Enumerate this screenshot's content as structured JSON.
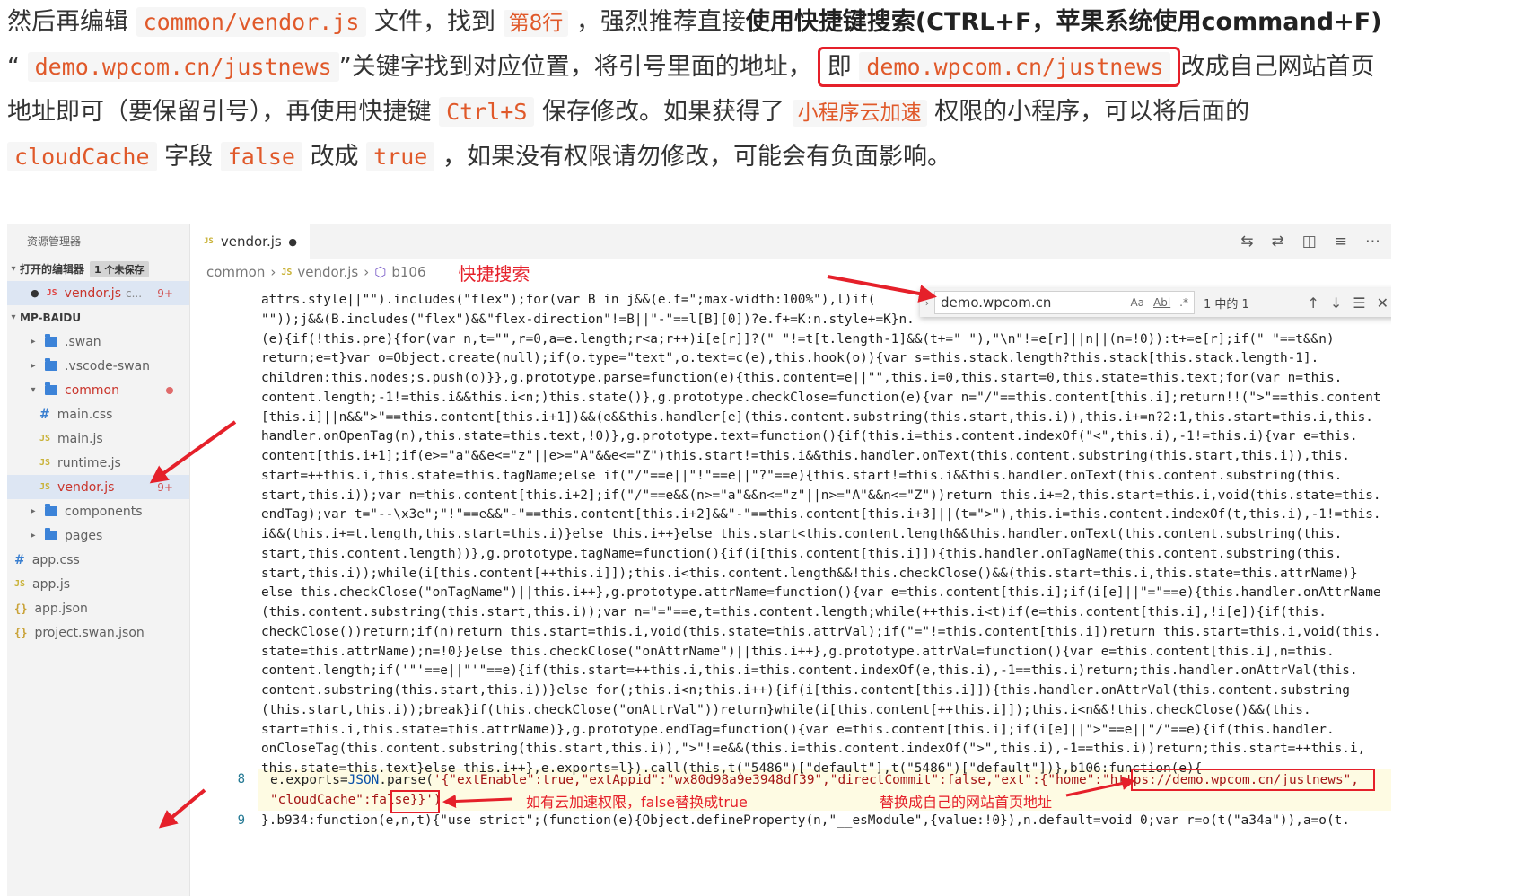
{
  "article": {
    "line1": {
      "t1": "然后再编辑",
      "file": "common/vendor.js",
      "t2": "文件，找到",
      "line_ref": "第8行",
      "t3": "，强烈推荐直接",
      "bold": "使用快捷键搜索(CTRL+F，苹果系统使用command+F)"
    },
    "line2": {
      "q1": "“",
      "domain": "demo.wpcom.cn/justnews",
      "t1": "”关键字找到对应位置，将引号里面的地址，",
      "boxed_prefix": "即",
      "boxed_domain": "demo.wpcom.cn/justnews",
      "t2": "改成自己网站首页"
    },
    "line3": {
      "t1": "地址即可（要保留引号），再使用快捷键",
      "shortcut": "Ctrl+S",
      "t2": "保存修改。如果获得了",
      "feature": "小程序云加速",
      "t3": "权限的小程序，可以将后面的"
    },
    "line4": {
      "field": "cloudCache",
      "t1": "字段",
      "from": "false",
      "t2": "改成",
      "to": "true",
      "t3": "，如果没有权限请勿修改，可能会有负面影响。"
    }
  },
  "sidebar": {
    "title": "资源管理器",
    "open_editors_label": "打开的编辑器",
    "unsaved_badge": "1 个未保存",
    "open_file": {
      "name": "vendor.js",
      "folder": "c...",
      "badge": "9+"
    },
    "project": "MP-BAIDU",
    "tree": [
      {
        "name": ".swan",
        "kind": "folder",
        "indent": 1
      },
      {
        "name": ".vscode-swan",
        "kind": "folder",
        "indent": 1
      },
      {
        "name": "common",
        "kind": "folder-open",
        "indent": 1
      },
      {
        "name": "main.css",
        "kind": "css",
        "indent": 2
      },
      {
        "name": "main.js",
        "kind": "js",
        "indent": 2
      },
      {
        "name": "runtime.js",
        "kind": "js",
        "indent": 2
      },
      {
        "name": "vendor.js",
        "kind": "js-active",
        "indent": 2,
        "badge": "9+"
      },
      {
        "name": "components",
        "kind": "folder",
        "indent": 1
      },
      {
        "name": "pages",
        "kind": "folder",
        "indent": 1
      },
      {
        "name": "app.css",
        "kind": "css",
        "indent": 0
      },
      {
        "name": "app.js",
        "kind": "js",
        "indent": 0
      },
      {
        "name": "app.json",
        "kind": "json",
        "indent": 0
      },
      {
        "name": "project.swan.json",
        "kind": "json",
        "indent": 0
      }
    ]
  },
  "tab": {
    "label": "vendor.js",
    "modified": "●",
    "icon": "JS"
  },
  "breadcrumb": {
    "folder": "common",
    "file": "vendor.js",
    "symbol": "b106"
  },
  "find": {
    "query": "demo.wpcom.cn",
    "opt_case": "Aa",
    "opt_word": "Abl",
    "opt_regex": ".*",
    "count": "1 中的 1"
  },
  "annotations": {
    "search": "快捷搜索",
    "cloud": "如有云加速权限，false替换成true",
    "url": "替换成自己的网站首页地址"
  },
  "gutter": {
    "line8": "8",
    "line9": "9"
  },
  "code_lines": [
    "attrs.style||\"\").includes(\"flex\");for(var B in j&&(e.f=\";max-width:100%\"),l)if(",
    "\"\"));j&&(B.includes(\"flex\")&&\"flex-direction\"!=B||\"-\"==l[B][0])?e.f+=K:n.style+=K}n.",
    "(e){if(!this.pre){for(var n,t=\"\",r=0,a=e.length;r<a;r++)i[e[r]]?(\" \"!=t[t.length-1]&&(t+=\" \"),\"\\n\"!=e[r]||n||(n=!0)):t+=e[r];if(\" \"==t&&n)",
    "return;e=t}var o=Object.create(null);if(o.type=\"text\",o.text=c(e),this.hook(o)){var s=this.stack.length?this.stack[this.stack.length-1].",
    "children:this.nodes;s.push(o)}},g.prototype.parse=function(e){this.content=e||\"\",this.i=0,this.start=0,this.state=this.text;for(var n=this.",
    "content.length;-1!=this.i&&this.i<n;)this.state()},g.prototype.checkClose=function(e){var n=\"/\"==this.content[this.i];return!!(\">\"==this.content",
    "[this.i]||n&&\">\"==this.content[this.i+1])&&(e&&this.handler[e](this.content.substring(this.start,this.i)),this.i+=n?2:1,this.start=this.i,this.",
    "handler.onOpenTag(n),this.state=this.text,!0)},g.prototype.text=function(){if(this.i=this.content.indexOf(\"<\",this.i),-1!=this.i){var e=this.",
    "content[this.i+1];if(e>=\"a\"&&e<=\"z\"||e>=\"A\"&&e<=\"Z\")this.start!=this.i&&this.handler.onText(this.content.substring(this.start,this.i)),this.",
    "start=++this.i,this.state=this.tagName;else if(\"/\"==e||\"!\"==e||\"?\"==e){this.start!=this.i&&this.handler.onText(this.content.substring(this.",
    "start,this.i));var n=this.content[this.i+2];if(\"/\"==e&&(n>=\"a\"&&n<=\"z\"||n>=\"A\"&&n<=\"Z\"))return this.i+=2,this.start=this.i,void(this.state=this.",
    "endTag);var t=\"--\\x3e\";\"!\"==e&&\"-\"==this.content[this.i+2]&&\"-\"==this.content[this.i+3]||(t=\">\"),this.i=this.content.indexOf(t,this.i),-1!=this.",
    "i&&(this.i+=t.length,this.start=this.i)}else this.i++}else this.start<this.content.length&&this.handler.onText(this.content.substring(this.",
    "start,this.content.length))},g.prototype.tagName=function(){if(i[this.content[this.i]]){this.handler.onTagName(this.content.substring(this.",
    "start,this.i));while(i[this.content[++this.i]]);this.i<this.content.length&&!this.checkClose()&&(this.start=this.i,this.state=this.attrName)}",
    "else this.checkClose(\"onTagName\")||this.i++},g.prototype.attrName=function(){var e=this.content[this.i];if(i[e]||\"=\"==e){this.handler.onAttrName",
    "(this.content.substring(this.start,this.i));var n=\"=\"==e,t=this.content.length;while(++this.i<t)if(e=this.content[this.i],!i[e]){if(this.",
    "checkClose())return;if(n)return this.start=this.i,void(this.state=this.attrVal);if(\"=\"!=this.content[this.i])return this.start=this.i,void(this.",
    "state=this.attrName);n=!0}}else this.checkClose(\"onAttrName\")||this.i++},g.prototype.attrVal=function(){var e=this.content[this.i],n=this.",
    "content.length;if('\"'==e||\"'\"==e){if(this.start=++this.i,this.i=this.content.indexOf(e,this.i),-1==this.i)return;this.handler.onAttrVal(this.",
    "content.substring(this.start,this.i))}else for(;this.i<n;this.i++){if(i[this.content[this.i]]){this.handler.onAttrVal(this.content.substring",
    "(this.start,this.i));break}if(this.checkClose(\"onAttrVal\"))return}while(i[this.content[++this.i]]);this.i<n&&!this.checkClose()&&(this.",
    "start=this.i,this.state=this.attrName)},g.prototype.endTag=function(){var e=this.content[this.i];if(i[e]||\">\"==e||\"/\"==e){if(this.handler.",
    "onCloseTag(this.content.substring(this.start,this.i)),\">\"!=e&&(this.i=this.content.indexOf(\">\",this.i),-1==this.i))return;this.start=++this.i,",
    "this.state=this.text}else this.i++},e.exports=l}).call(this,t(\"5486\")[\"default\"],t(\"5486\")[\"default\"])},b106:function(e){"
  ],
  "line8": {
    "a": "e.exports=",
    "b": "JSON",
    "c": ".parse(",
    "d": "'{\"extEnable\":true,\"extAppid\":\"wx80d98a9e3948df39\",\"directCommit\":false,\"ext\":{\"home\":\"",
    "url": "https://demo.wpcom.cn/justnews",
    "e": "\",",
    "f": "\"cloudCache\":",
    "false": "false",
    "g": "}}')"
  },
  "line9": "}.b934:function(e,n,t){\"use strict\";(function(e){Object.defineProperty(n,\"__esModule\",{value:!0}),n.default=void 0;var r=o(t(\"a34a\")),a=o(t."
}
